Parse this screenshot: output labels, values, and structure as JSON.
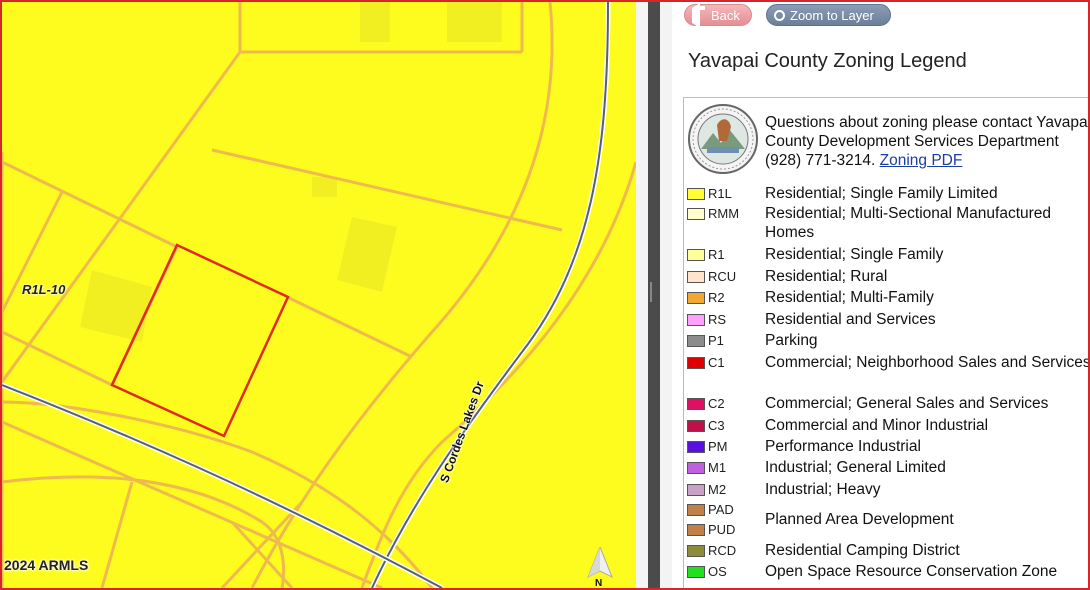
{
  "map": {
    "zone_label": "R1L-10",
    "road_label": "S Cordes Lakes Dr",
    "copyright": "2024 ARMLS",
    "north_label": "N",
    "colors": {
      "fill": "#fdfc1e",
      "parcel_lines": "#efb94d",
      "selected_parcel": "#e02a22",
      "road": "#556070"
    }
  },
  "panel": {
    "back_label": "Back",
    "zoom_label": "Zoom to Layer",
    "title": "Yavapai County Zoning Legend",
    "contact": {
      "text": "Questions about zoning please contact Yavapai County Development Services Department (928) 771-3214.",
      "link_label": "Zoning PDF"
    },
    "legend": [
      {
        "code": "R1L",
        "label": "Residential; Single Family Limited",
        "color": "#ffff33"
      },
      {
        "code": "RMM",
        "label": "Residential; Multi-Sectional Manufactured Homes",
        "color": "#ffffcc"
      },
      {
        "code": "R1",
        "label": "Residential; Single Family",
        "color": "#ffff99"
      },
      {
        "code": "RCU",
        "label": "Residential; Rural",
        "color": "#ffe4cc"
      },
      {
        "code": "R2",
        "label": "Residential; Multi-Family",
        "color": "#f0a830"
      },
      {
        "code": "RS",
        "label": "Residential and Services",
        "color": "#ffa0ff"
      },
      {
        "code": "P1",
        "label": "Parking",
        "color": "#8c8c8c"
      },
      {
        "code": "C1",
        "label": "Commercial; Neighborhood Sales and Services",
        "color": "#e00000"
      },
      {
        "code": "C2",
        "label": "Commercial; General Sales and Services",
        "color": "#e01060"
      },
      {
        "code": "C3",
        "label": "Commercial and Minor Industrial",
        "color": "#c0104a"
      },
      {
        "code": "PM",
        "label": "Performance Industrial",
        "color": "#5a10e0"
      },
      {
        "code": "M1",
        "label": "Industrial; General Limited",
        "color": "#c060e0"
      },
      {
        "code": "M2",
        "label": "Industrial; Heavy",
        "color": "#c8a0c8"
      },
      {
        "code": "PAD",
        "label": "",
        "color": "#c08048"
      },
      {
        "code": "PUD",
        "label": "Planned Area Development",
        "color": "#c08048"
      },
      {
        "code": "RCD",
        "label": "Residential Camping District",
        "color": "#8c8c3c"
      },
      {
        "code": "OS",
        "label": "Open Space Resource Conservation Zone",
        "color": "#20e020"
      }
    ]
  }
}
